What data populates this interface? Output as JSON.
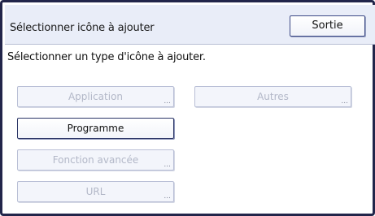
{
  "header": {
    "title": "Sélectionner icône à ajouter",
    "exit_label": "Sortie"
  },
  "instruction": "Sélectionner un type d'icône à ajouter.",
  "buttons": {
    "application": {
      "label": "Application",
      "suffix": "...",
      "enabled": false
    },
    "autres": {
      "label": "Autres",
      "suffix": "...",
      "enabled": false
    },
    "programme": {
      "label": "Programme",
      "enabled": true
    },
    "fonction_avancee": {
      "label": "Fonction avancée",
      "suffix": "...",
      "enabled": false
    },
    "url": {
      "label": "URL",
      "suffix": "...",
      "enabled": false
    }
  },
  "colors": {
    "frame": "#22254a",
    "header_bg": "#e9edf8",
    "disabled_text": "#b3b8c8",
    "enabled_border": "#2b3566"
  }
}
